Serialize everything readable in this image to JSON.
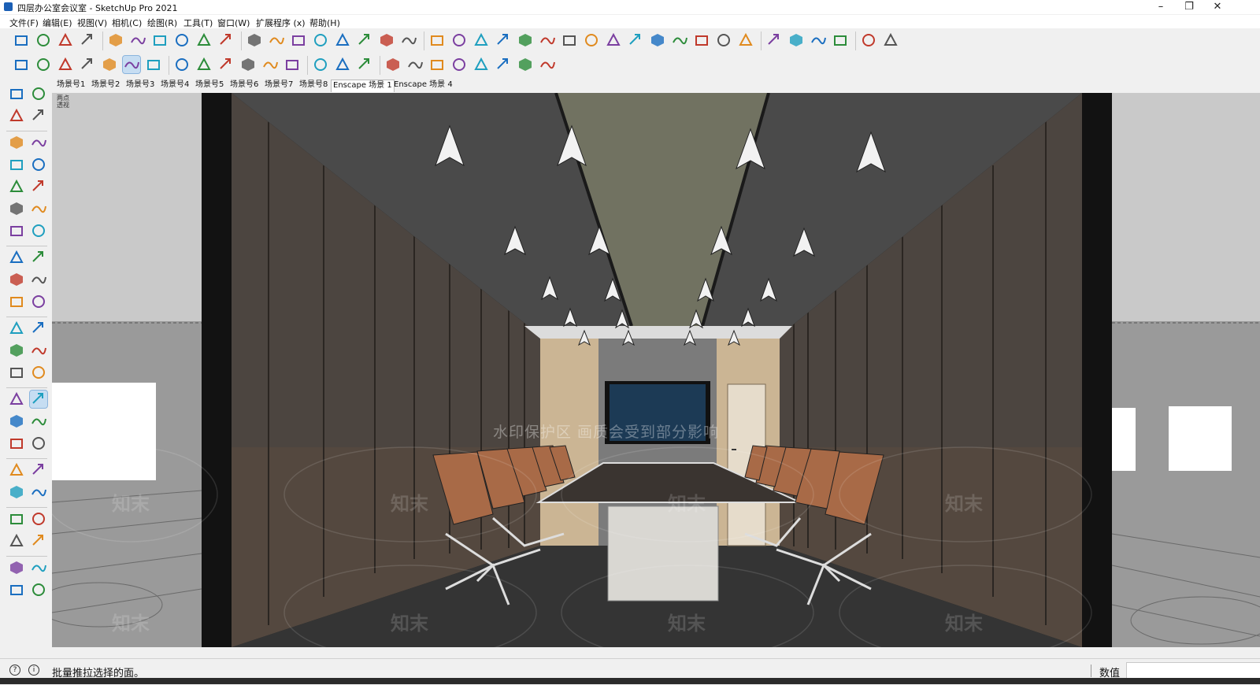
{
  "window": {
    "title": "四层办公室会议室 - SketchUp Pro 2021"
  },
  "window_controls": {
    "minimize": "–",
    "maximize": "❐",
    "close": "✕"
  },
  "menu": [
    "文件(F)",
    "编辑(E)",
    "视图(V)",
    "相机(C)",
    "绘图(R)",
    "工具(T)",
    "窗口(W)",
    "扩展程序 (x)",
    "帮助(H)"
  ],
  "toolbar_top": [
    "cloud-icon",
    "cloud-search-icon",
    "cloud-upload-icon",
    "cloud-outline-icon",
    "frame-icon",
    "component-icon",
    "refresh-icon",
    "download-icon",
    "settings-icon",
    "chrome-icon",
    "pyramid-icon",
    "building-icon",
    "import-icon",
    "push-icon",
    "box-icon",
    "curve-s-icon",
    "eye-target-icon",
    "select-box-icon",
    "line-tool-icon",
    "push-arrow-icon",
    "pen-edit-icon",
    "green-angle-icon",
    "bezier-icon",
    "arc-small-icon",
    "arc-icon",
    "cursor-arrow-icon",
    "curve-red-icon",
    "scissors-line-icon",
    "zoom-curve-icon",
    "rounded-rect-icon",
    "spiral-icon",
    "rect-outline-icon",
    "shear-rect-icon",
    "red-box-icon",
    "blue-panel-icon",
    "shape-door-icon",
    "shape-3d-icon",
    "arc-plus-icon",
    "basket-icon"
  ],
  "toolbar_second": [
    "solid-box-icon",
    "outline-box-icon",
    "iso-box-icon",
    "plane-icon",
    "cube-shade-icon",
    "layers-active-icon",
    "blue-box-icon",
    "house-3d-icon",
    "wall-icon",
    "house-icon",
    "garage-icon",
    "house-outline-icon",
    "store-icon",
    "enscape-icon",
    "sync-icon",
    "render-icon",
    "plus-icon",
    "tree-icon",
    "sun-icon",
    "checker-icon",
    "upload-cloud-icon",
    "gear-icon",
    "mail-icon",
    "info-icon"
  ],
  "left_toolbar": [
    "select-icon",
    "component-make-icon",
    "paint-bucket-icon",
    "eraser-icon",
    "pencil-icon",
    "freehand-icon",
    "rectangle-icon",
    "rotated-rect-icon",
    "circle-icon",
    "polygon-icon",
    "arc-tool-icon",
    "pie-icon",
    "three-point-arc-icon",
    "arc-2-icon",
    "move-icon",
    "push-pull-icon",
    "rotate-icon",
    "follow-me-icon",
    "scale-icon",
    "offset-icon",
    "tape-measure-icon",
    "dimension-icon",
    "protractor-icon",
    "text-icon",
    "axes-icon",
    "3d-text-icon",
    "orbit-icon",
    "pan-icon",
    "zoom-icon",
    "zoom-window-icon",
    "zoom-extents-icon",
    "previous-view-icon",
    "position-camera-icon",
    "look-around-icon",
    "walk-icon",
    "section-plane-icon",
    "sandbox-icon",
    "terrain-icon",
    "layers-tool-icon",
    "stamp-icon",
    "section-cut-icon",
    "iso-view-icon",
    "box-view-icon",
    "blue-cube-icon"
  ],
  "scene_tabs": [
    "场景号1",
    "场景号2",
    "场景号3",
    "场景号4",
    "场景号5",
    "场景号6",
    "场景号7",
    "场景号8",
    "Enscape 场景 1",
    "Enscape 场景 4"
  ],
  "active_scene": "Enscape 场景 1",
  "viewport": {
    "perspective_label_1": "两点",
    "perspective_label_2": "透视",
    "watermark_banner": "水印保护区  画质会受到部分影响",
    "watermark_logo": "知末"
  },
  "status": {
    "hint": "批量推拉选择的面。",
    "value_label": "数值",
    "value": ""
  },
  "colors": {
    "accent": "#1b5fb5",
    "wall_wood": "#4c4540",
    "ceiling": "#4a4a4a",
    "ceiling_panel": "#717261",
    "chair": "#a86a47",
    "floor": "#343434",
    "monitor_screen": "#1c3a55"
  }
}
